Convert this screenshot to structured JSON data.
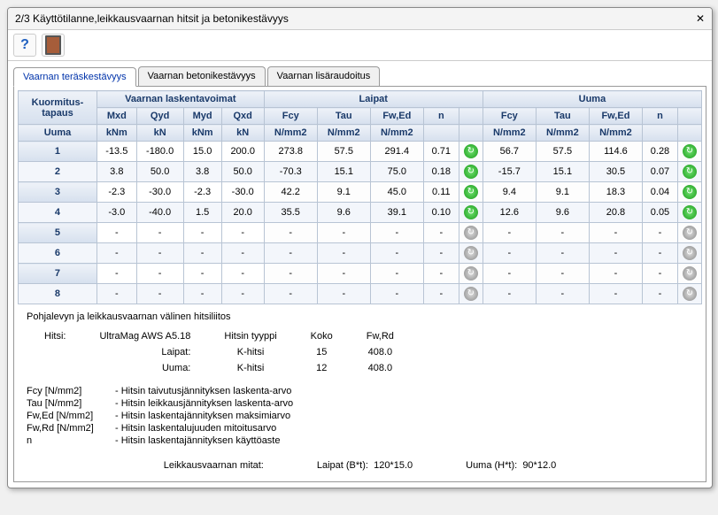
{
  "title": "2/3  Käyttötilanne,leikkausvaarnan hitsit ja betonikestävyys",
  "tabs": {
    "t1": "Vaarnan teräskestävyys",
    "t2": "Vaarnan betonikestävyys",
    "t3": "Vaarnan lisäraudoitus"
  },
  "headers": {
    "group1": "Kuormitus-\ntapaus",
    "group2": "Vaarnan laskentavoimat",
    "group3": "Laipat",
    "group4": "Uuma",
    "mxd": "Mxd",
    "qyd": "Qyd",
    "myd": "Myd",
    "qxd": "Qxd",
    "fcy": "Fcy",
    "tau": "Tau",
    "fwed": "Fw,Ed",
    "n": "n",
    "uuma": "Uuma",
    "u_knm": "kNm",
    "u_kn": "kN",
    "u_nmm2": "N/mm2"
  },
  "rows": [
    {
      "id": "1",
      "mxd": "-13.5",
      "qyd": "-180.0",
      "myd": "15.0",
      "qxd": "200.0",
      "l_fcy": "273.8",
      "l_tau": "57.5",
      "l_fwed": "291.4",
      "l_n": "0.71",
      "l_s": "g",
      "u_fcy": "56.7",
      "u_tau": "57.5",
      "u_fwed": "114.6",
      "u_n": "0.28",
      "u_s": "g"
    },
    {
      "id": "2",
      "mxd": "3.8",
      "qyd": "50.0",
      "myd": "3.8",
      "qxd": "50.0",
      "l_fcy": "-70.3",
      "l_tau": "15.1",
      "l_fwed": "75.0",
      "l_n": "0.18",
      "l_s": "g",
      "u_fcy": "-15.7",
      "u_tau": "15.1",
      "u_fwed": "30.5",
      "u_n": "0.07",
      "u_s": "g"
    },
    {
      "id": "3",
      "mxd": "-2.3",
      "qyd": "-30.0",
      "myd": "-2.3",
      "qxd": "-30.0",
      "l_fcy": "42.2",
      "l_tau": "9.1",
      "l_fwed": "45.0",
      "l_n": "0.11",
      "l_s": "g",
      "u_fcy": "9.4",
      "u_tau": "9.1",
      "u_fwed": "18.3",
      "u_n": "0.04",
      "u_s": "g"
    },
    {
      "id": "4",
      "mxd": "-3.0",
      "qyd": "-40.0",
      "myd": "1.5",
      "qxd": "20.0",
      "l_fcy": "35.5",
      "l_tau": "9.6",
      "l_fwed": "39.1",
      "l_n": "0.10",
      "l_s": "g",
      "u_fcy": "12.6",
      "u_tau": "9.6",
      "u_fwed": "20.8",
      "u_n": "0.05",
      "u_s": "g"
    },
    {
      "id": "5",
      "mxd": "-",
      "qyd": "-",
      "myd": "-",
      "qxd": "-",
      "l_fcy": "-",
      "l_tau": "-",
      "l_fwed": "-",
      "l_n": "-",
      "l_s": "x",
      "u_fcy": "-",
      "u_tau": "-",
      "u_fwed": "-",
      "u_n": "-",
      "u_s": "x"
    },
    {
      "id": "6",
      "mxd": "-",
      "qyd": "-",
      "myd": "-",
      "qxd": "-",
      "l_fcy": "-",
      "l_tau": "-",
      "l_fwed": "-",
      "l_n": "-",
      "l_s": "x",
      "u_fcy": "-",
      "u_tau": "-",
      "u_fwed": "-",
      "u_n": "-",
      "u_s": "x"
    },
    {
      "id": "7",
      "mxd": "-",
      "qyd": "-",
      "myd": "-",
      "qxd": "-",
      "l_fcy": "-",
      "l_tau": "-",
      "l_fwed": "-",
      "l_n": "-",
      "l_s": "x",
      "u_fcy": "-",
      "u_tau": "-",
      "u_fwed": "-",
      "u_n": "-",
      "u_s": "x"
    },
    {
      "id": "8",
      "mxd": "-",
      "qyd": "-",
      "myd": "-",
      "qxd": "-",
      "l_fcy": "-",
      "l_tau": "-",
      "l_fwed": "-",
      "l_n": "-",
      "l_s": "x",
      "u_fcy": "-",
      "u_tau": "-",
      "u_fwed": "-",
      "u_n": "-",
      "u_s": "x"
    }
  ],
  "info": {
    "heading": "Pohjalevyn ja leikkausvaarnan välinen hitsiliitos",
    "hitsi_lbl": "Hitsi:",
    "hitsi_val": "UltraMag AWS A5.18",
    "hitsin_tyyppi_lbl": "Hitsin tyyppi",
    "koko_lbl": "Koko",
    "fwrd_lbl": "Fw,Rd",
    "laipat_lbl": "Laipat:",
    "uuma_lbl": "Uuma:",
    "laipat_type": "K-hitsi",
    "laipat_koko": "15",
    "laipat_fwrd": "408.0",
    "uuma_type": "K-hitsi",
    "uuma_koko": "12",
    "uuma_fwrd": "408.0"
  },
  "legend": {
    "fcy_k": "Fcy [N/mm2]",
    "fcy_v": "- Hitsin taivutusjännityksen laskenta-arvo",
    "tau_k": "Tau [N/mm2]",
    "tau_v": "- Hitsin leikkausjännityksen laskenta-arvo",
    "fwed_k": "Fw,Ed [N/mm2]",
    "fwed_v": "- Hitsin laskentajännityksen maksimiarvo",
    "fwrd_k": "Fw,Rd [N/mm2]",
    "fwrd_v": "- Hitsin laskentalujuuden mitoitusarvo",
    "n_k": "n",
    "n_v": "- Hitsin laskentajännityksen käyttöaste"
  },
  "bottom": {
    "dims_lbl": "Leikkausvaarnan mitat:",
    "laipat_k": "Laipat (B*t):",
    "laipat_v": "120*15.0",
    "uuma_k": "Uuma (H*t):",
    "uuma_v": "90*12.0"
  }
}
